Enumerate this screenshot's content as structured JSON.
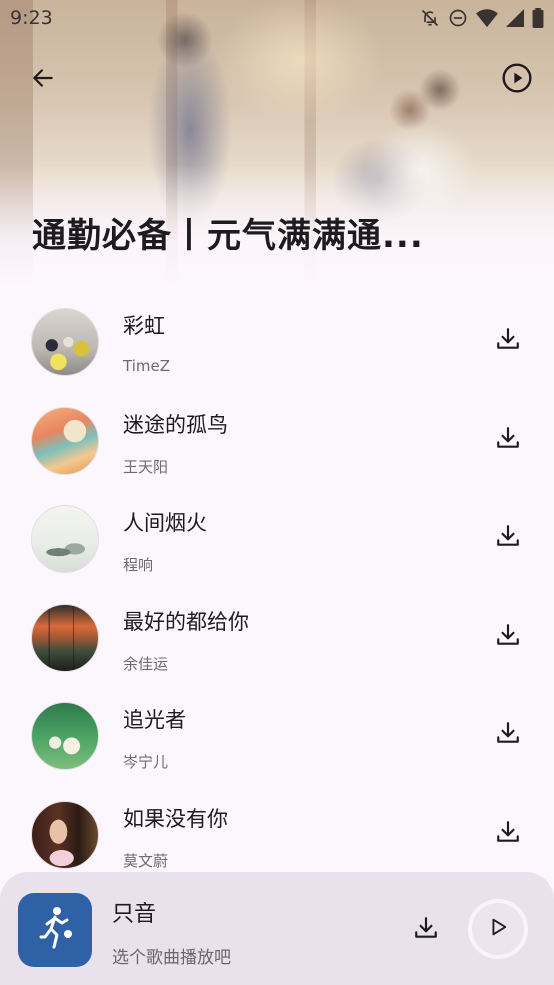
{
  "status_bar": {
    "time": "9:23",
    "icons": [
      "notifications-off-icon",
      "do-not-disturb-icon",
      "wifi-icon",
      "signal-icon",
      "battery-icon"
    ]
  },
  "header": {
    "back_icon": "arrow-back-icon",
    "play_all_icon": "play-circle-icon",
    "playlist_title": "通勤必备丨元气满满通..."
  },
  "songs": [
    {
      "title": "彩虹",
      "artist": "TimeZ"
    },
    {
      "title": "迷途的孤鸟",
      "artist": "王天阳"
    },
    {
      "title": "人间烟火",
      "artist": "程响"
    },
    {
      "title": "最好的都给你",
      "artist": "余佳运"
    },
    {
      "title": "追光者",
      "artist": "岑宁儿"
    },
    {
      "title": "如果没有你",
      "artist": "莫文蔚"
    }
  ],
  "mini_player": {
    "title": "只音",
    "subtitle": "选个歌曲播放吧",
    "art_icon": "basketball-player-icon",
    "download_icon": "download-icon",
    "play_icon": "play-icon"
  },
  "colors": {
    "background": "#fcf7fc",
    "mini_player_bg": "#e9e1ec",
    "mini_player_art": "#2f61a6",
    "text_primary": "#1c1b1f",
    "text_secondary": "#6f6a70"
  }
}
